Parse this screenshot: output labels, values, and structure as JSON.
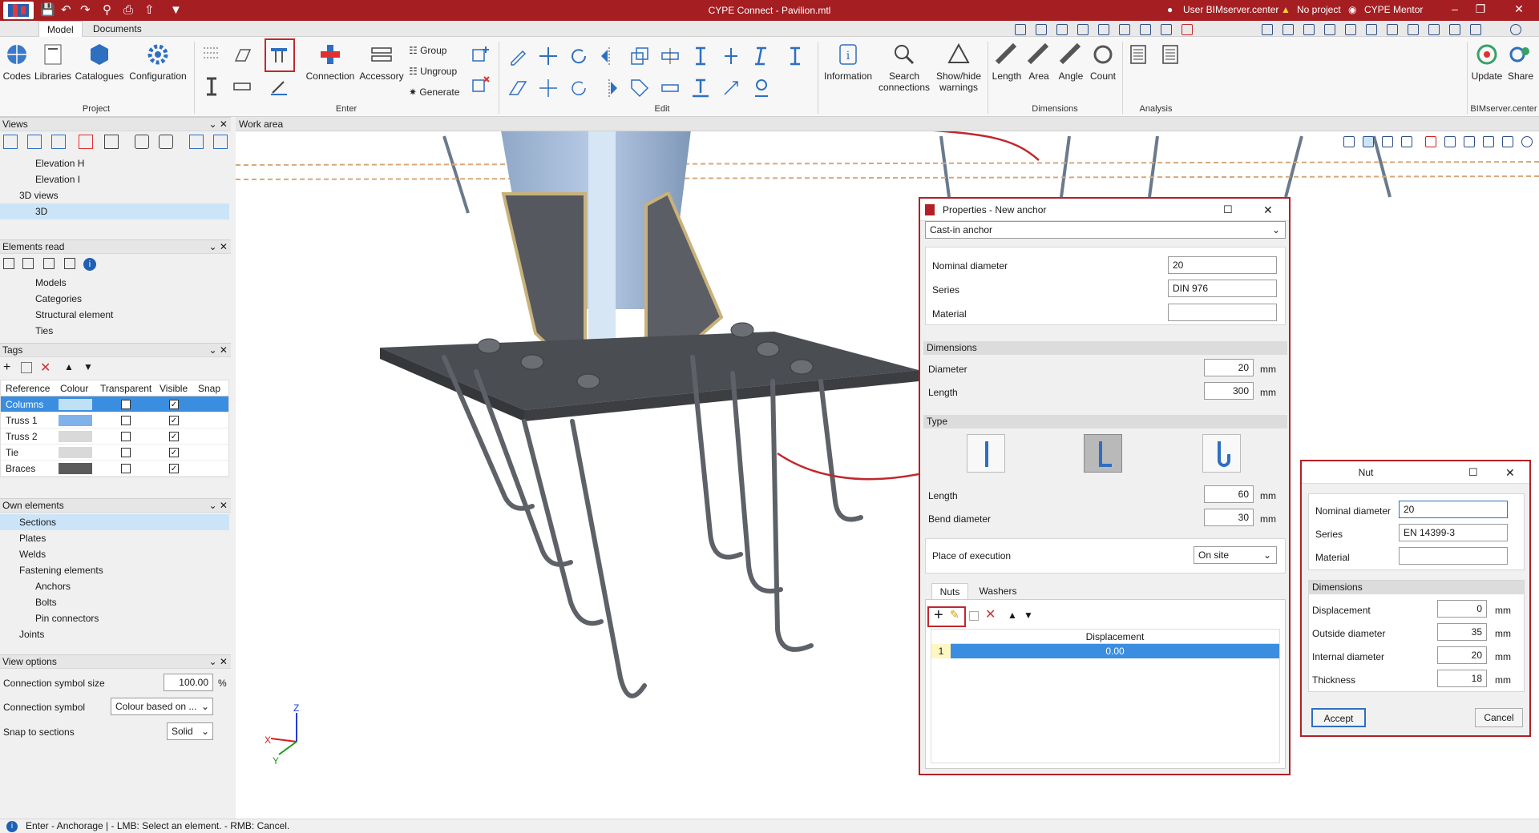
{
  "app": {
    "title": "CYPE Connect - Pavilion.mtl",
    "user": "User BIMserver.center",
    "project": "No project",
    "mentor": "CYPE Mentor"
  },
  "menu_tabs": [
    "Model",
    "Documents"
  ],
  "ribbon": {
    "project": {
      "codes": "Codes",
      "libraries": "Libraries",
      "catalogues": "Catalogues",
      "configuration": "Configuration",
      "group": "Project"
    },
    "enter": {
      "connection": "Connection",
      "accessory": "Accessory",
      "group_btn": "Group",
      "ungroup": "Ungroup",
      "generate": "Generate",
      "group": "Enter"
    },
    "edit": {
      "group": "Edit"
    },
    "info": {
      "information": "Information",
      "search": "Search connections",
      "showhide": "Show/hide warnings"
    },
    "dimensions": {
      "length": "Length",
      "area": "Area",
      "angle": "Angle",
      "count": "Count",
      "group": "Dimensions"
    },
    "analysis": {
      "group": "Analysis"
    },
    "bim": {
      "update": "Update",
      "share": "Share",
      "group": "BIMserver.center"
    }
  },
  "views_panel": {
    "title": "Views",
    "items": [
      "Elevation H",
      "Elevation I",
      "3D views",
      "3D"
    ]
  },
  "elements_panel": {
    "title": "Elements read",
    "items": [
      "Models",
      "Categories",
      "Structural element",
      "Ties"
    ]
  },
  "tags_panel": {
    "title": "Tags",
    "columns": [
      "Reference",
      "Colour",
      "Transparent",
      "Visible",
      "Snap"
    ],
    "rows": [
      {
        "name": "Columns",
        "color": "#bfe0f5",
        "transparent": false,
        "visible": true
      },
      {
        "name": "Truss 1",
        "color": "#7fb2ea",
        "transparent": false,
        "visible": true
      },
      {
        "name": "Truss 2",
        "color": "#d9d9d9",
        "transparent": false,
        "visible": true
      },
      {
        "name": "Tie",
        "color": "#d9d9d9",
        "transparent": false,
        "visible": true
      },
      {
        "name": "Braces",
        "color": "#5b5b5b",
        "transparent": false,
        "visible": true
      }
    ]
  },
  "own_panel": {
    "title": "Own elements",
    "items": [
      "Sections",
      "Plates",
      "Welds",
      "Fastening elements",
      "Anchors",
      "Bolts",
      "Pin connectors",
      "Joints"
    ]
  },
  "view_options": {
    "title": "View options",
    "symbol_size_label": "Connection symbol size",
    "symbol_size_value": "100.00",
    "symbol_size_unit": "%",
    "symbol_label": "Connection symbol",
    "symbol_value": "Colour based on ...",
    "snap_label": "Snap to sections",
    "snap_value": "Solid"
  },
  "work_area": {
    "title": "Work area"
  },
  "axes": {
    "z": "Z",
    "x": "X",
    "y": "Y"
  },
  "status": {
    "text": "Enter - Anchorage | - LMB: Select an element. - RMB: Cancel."
  },
  "props_dialog": {
    "title": "Properties - New anchor",
    "anchor_type": "Cast-in anchor",
    "nominal_diameter_label": "Nominal diameter",
    "nominal_diameter": "20",
    "series_label": "Series",
    "series": "DIN 976",
    "material_label": "Material",
    "material": "",
    "dimensions_title": "Dimensions",
    "diameter_label": "Diameter",
    "diameter": "20",
    "length_label": "Length",
    "length": "300",
    "unit": "mm",
    "type_title": "Type",
    "type_length_label": "Length",
    "type_length": "60",
    "bend_label": "Bend diameter",
    "bend": "30",
    "place_label": "Place of execution",
    "place": "On site",
    "tabs": [
      "Nuts",
      "Washers"
    ],
    "table_header": "Displacement",
    "rows": [
      {
        "index": "1",
        "displacement": "0.00"
      }
    ]
  },
  "nut_dialog": {
    "title": "Nut",
    "nominal_diameter_label": "Nominal diameter",
    "nominal_diameter": "20",
    "series_label": "Series",
    "series": "EN 14399-3",
    "material_label": "Material",
    "material": "",
    "dimensions_title": "Dimensions",
    "displacement_label": "Displacement",
    "displacement": "0",
    "outside_label": "Outside diameter",
    "outside": "35",
    "internal_label": "Internal diameter",
    "internal": "20",
    "thickness_label": "Thickness",
    "thickness": "18",
    "unit": "mm",
    "accept": "Accept",
    "cancel": "Cancel"
  }
}
